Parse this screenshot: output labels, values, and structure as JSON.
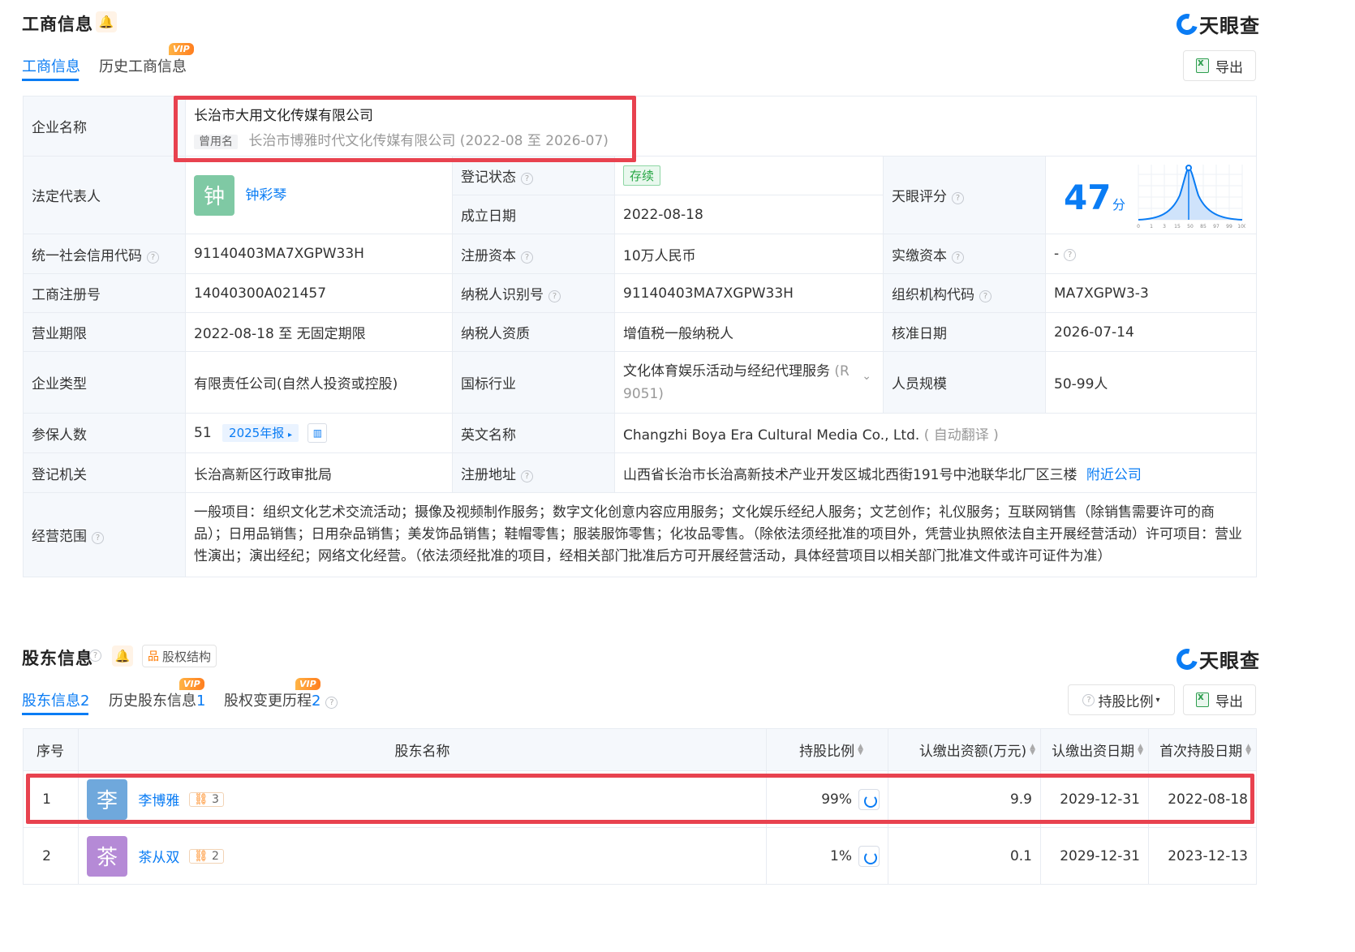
{
  "section1": {
    "title": "工商信息",
    "brand": "天眼查",
    "tabs": [
      {
        "label": "工商信息",
        "active": true
      },
      {
        "label": "历史工商信息",
        "vip": "VIP"
      }
    ],
    "export_label": "导出",
    "company_name": {
      "label": "企业名称",
      "value": "长治市大用文化传媒有限公司",
      "former_tag": "曾用名",
      "former_value": "长治市博雅时代文化传媒有限公司 (2022-08 至 2026-07)"
    },
    "legal_rep": {
      "label": "法定代表人",
      "avatar_char": "钟",
      "name": "钟彩琴"
    },
    "reg_status": {
      "label": "登记状态",
      "value": "存续"
    },
    "found_date": {
      "label": "成立日期",
      "value": "2022-08-18"
    },
    "tianyan_score": {
      "label": "天眼评分",
      "value": "47",
      "unit": "分",
      "axis_ticks": [
        "0",
        "1",
        "3",
        "15",
        "50",
        "85",
        "97",
        "99",
        "100"
      ]
    },
    "credit_code": {
      "label": "统一社会信用代码",
      "value": "91140403MA7XGPW33H"
    },
    "reg_capital": {
      "label": "注册资本",
      "value": "10万人民币"
    },
    "paid_capital": {
      "label": "实缴资本",
      "value": "-"
    },
    "reg_number": {
      "label": "工商注册号",
      "value": "14040300A021457"
    },
    "taxpayer_id": {
      "label": "纳税人识别号",
      "value": "91140403MA7XGPW33H"
    },
    "org_code": {
      "label": "组织机构代码",
      "value": "MA7XGPW3-3"
    },
    "business_term": {
      "label": "营业期限",
      "value": "2022-08-18 至 无固定期限"
    },
    "taxpayer_qual": {
      "label": "纳税人资质",
      "value": "增值税一般纳税人"
    },
    "approval_date": {
      "label": "核准日期",
      "value": "2026-07-14"
    },
    "company_type": {
      "label": "企业类型",
      "value": "有限责任公司(自然人投资或控股)"
    },
    "industry": {
      "label": "国标行业",
      "value": "文化体育娱乐活动与经纪代理服务",
      "code_line1": "(R",
      "code_line2": "9051)"
    },
    "staff_size": {
      "label": "人员规模",
      "value": "50-99人"
    },
    "insured": {
      "label": "参保人数",
      "value": "51",
      "report_tag": "2025年报"
    },
    "english_name": {
      "label": "英文名称",
      "value": "Changzhi Boya Era Cultural Media Co., Ltd.",
      "note": "( 自动翻译 )"
    },
    "reg_authority": {
      "label": "登记机关",
      "value": "长治高新区行政审批局"
    },
    "reg_address": {
      "label": "注册地址",
      "value": "山西省长治市长治高新技术产业开发区城北西街191号中池联华北厂区三楼",
      "nearby": "附近公司"
    },
    "scope": {
      "label": "经营范围",
      "value": "一般项目：组织文化艺术交流活动；摄像及视频制作服务；数字文化创意内容应用服务；文化娱乐经纪人服务；文艺创作；礼仪服务；互联网销售（除销售需要许可的商品）；日用品销售；日用杂品销售；美发饰品销售；鞋帽零售；服装服饰零售；化妆品零售。（除依法须经批准的项目外，凭营业执照依法自主开展经营活动）许可项目：营业性演出；演出经纪；网络文化经营。（依法须经批准的项目，经相关部门批准后方可开展经营活动，具体经营项目以相关部门批准文件或许可证件为准）"
    }
  },
  "section2": {
    "title": "股东信息",
    "equity_btn": "股权结构",
    "brand": "天眼查",
    "tabs": [
      {
        "label": "股东信息",
        "count": "2",
        "active": true
      },
      {
        "label": "历史股东信息",
        "count": "1",
        "vip": "VIP"
      },
      {
        "label": "股权变更历程",
        "count": "2",
        "vip": "VIP"
      }
    ],
    "ratio_filter": "持股比例",
    "export_label": "导出",
    "columns": [
      "序号",
      "股东名称",
      "持股比例",
      "认缴出资额(万元)",
      "认缴出资日期",
      "首次持股日期"
    ],
    "rows": [
      {
        "index": "1",
        "avatar_char": "李",
        "avatar_color": "#6fa8dc",
        "name": "李博雅",
        "link_count": "3",
        "ratio": "99%",
        "amount": "9.9",
        "sub_date": "2029-12-31",
        "first_date": "2022-08-18"
      },
      {
        "index": "2",
        "avatar_char": "茶",
        "avatar_color": "#b58ad6",
        "name": "茶从双",
        "link_count": "2",
        "ratio": "1%",
        "amount": "0.1",
        "sub_date": "2029-12-31",
        "first_date": "2023-12-13"
      }
    ]
  },
  "colors": {
    "accent": "#0a7cf4",
    "highlight_box": "#e8424f",
    "status_green": "#28a745",
    "vip_orange": "#ff7e1f"
  }
}
